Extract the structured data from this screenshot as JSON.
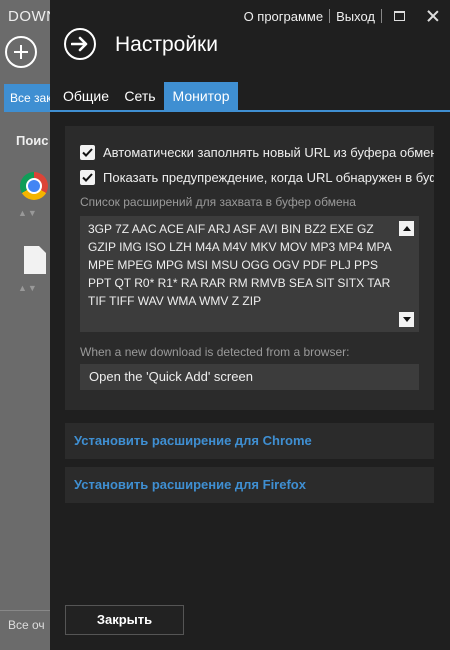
{
  "background_app": {
    "title": "DOWN",
    "tab_label": "Все зак",
    "search_label": "Поис",
    "bottom_text": "Все оч"
  },
  "topbar": {
    "about": "О программе",
    "exit": "Выход"
  },
  "page_title": "Настройки",
  "tabs": [
    {
      "label": "Общие",
      "active": false
    },
    {
      "label": "Сеть",
      "active": false
    },
    {
      "label": "Монитор",
      "active": true
    }
  ],
  "monitor": {
    "auto_fill": {
      "label": "Автоматически заполнять новый URL из буфера обмена",
      "checked": true
    },
    "warn": {
      "label": "Показать предупреждение, когда URL обнаружен в буфер",
      "checked": true
    },
    "ext_list_label": "Список расширений для захвата в буфер обмена",
    "ext_list_value": "3GP 7Z AAC ACE AIF ARJ ASF AVI BIN BZ2 EXE GZ GZIP IMG ISO LZH M4A M4V MKV MOV MP3 MP4 MPA MPE MPEG MPG MSI MSU OGG OGV PDF PLJ PPS PPT QT R0* R1* RA RAR RM RMVB SEA SIT SITX TAR TIF TIFF WAV WMA WMV Z ZIP",
    "browser_label": "When a new download is detected from a browser:",
    "browser_action": "Open the 'Quick Add' screen"
  },
  "links": {
    "chrome": "Установить расширение для Chrome",
    "firefox": "Установить расширение для Firefox"
  },
  "close_label": "Закрыть",
  "colors": {
    "accent": "#3f8fd2",
    "panel": "#1f1f1f",
    "card": "#2b2b2b"
  }
}
